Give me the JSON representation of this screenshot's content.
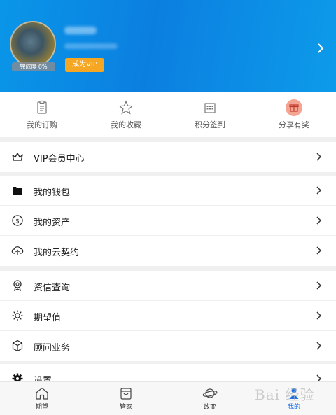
{
  "profile": {
    "completion": "完成度 0%",
    "vip_button": "成为VIP"
  },
  "quick_actions": [
    {
      "label": "我的订购",
      "icon": "clipboard-icon"
    },
    {
      "label": "我的收藏",
      "icon": "star-icon"
    },
    {
      "label": "积分签到",
      "icon": "calendar-grid-icon"
    },
    {
      "label": "分享有奖",
      "icon": "gift-icon"
    }
  ],
  "menu": {
    "vip": {
      "label": "VIP会员中心",
      "icon": "crown-icon"
    },
    "finance": [
      {
        "label": "我的钱包",
        "icon": "folder-icon"
      },
      {
        "label": "我的资产",
        "icon": "dollar-circle-icon"
      },
      {
        "label": "我的云契约",
        "icon": "cloud-upload-icon"
      }
    ],
    "services": [
      {
        "label": "资信查询",
        "icon": "badge-icon"
      },
      {
        "label": "期望值",
        "icon": "sun-icon"
      },
      {
        "label": "顾问业务",
        "icon": "cube-icon"
      }
    ],
    "settings": {
      "label": "设置",
      "icon": "gear-icon"
    }
  },
  "tabbar": [
    {
      "label": "期望",
      "icon": "home-icon"
    },
    {
      "label": "管家",
      "icon": "shopping-bag-icon"
    },
    {
      "label": "改变",
      "icon": "planet-icon"
    },
    {
      "label": "我的",
      "icon": "person-icon",
      "active": true
    }
  ],
  "watermark": "Bai 经验",
  "colors": {
    "header": "#0b8be4",
    "vip_button": "#f5a623",
    "active_tab": "#1a73e8"
  }
}
